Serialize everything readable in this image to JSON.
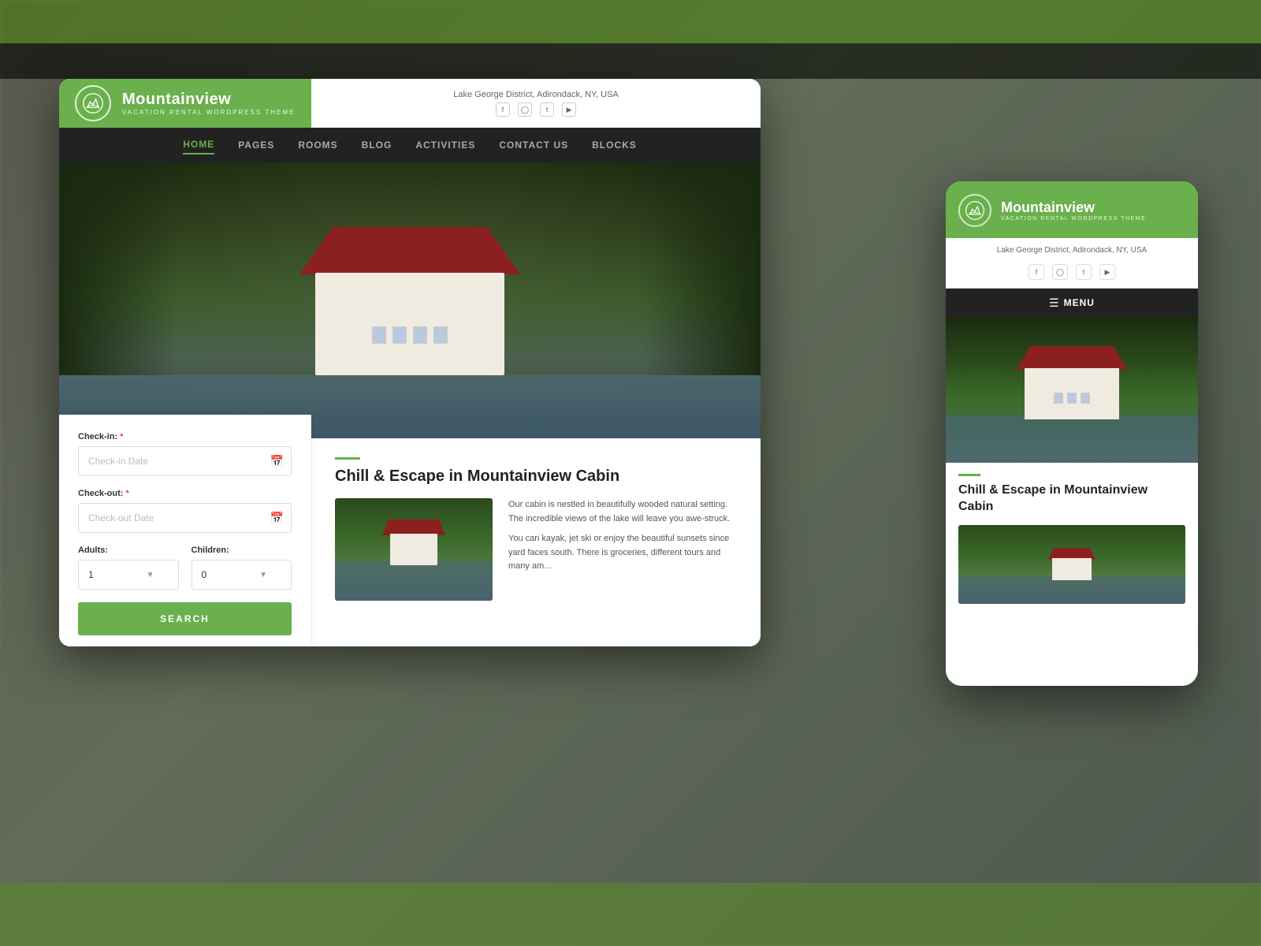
{
  "background": {
    "color": "#555555"
  },
  "desktop": {
    "logo": {
      "title": "Mountainview",
      "subtitle": "VACATION RENTAL WORDPRESS THEME"
    },
    "header": {
      "location": "Lake George District, Adirondack, NY, USA",
      "social": [
        "f",
        "in",
        "tw",
        "yt"
      ]
    },
    "nav": {
      "items": [
        {
          "label": "HOME",
          "active": true
        },
        {
          "label": "PAGES",
          "active": false
        },
        {
          "label": "ROOMS",
          "active": false
        },
        {
          "label": "BLOG",
          "active": false
        },
        {
          "label": "ACTIVITIES",
          "active": false
        },
        {
          "label": "CONTACT US",
          "active": false
        },
        {
          "label": "BLOCKS",
          "active": false
        }
      ]
    },
    "booking": {
      "checkin_label": "Check-in:",
      "checkin_placeholder": "Check-in Date",
      "checkout_label": "Check-out:",
      "checkout_placeholder": "Check-out Date",
      "adults_label": "Adults:",
      "adults_value": "1",
      "children_label": "Children:",
      "children_value": "0",
      "search_button": "SEARCH"
    },
    "content": {
      "section_title": "Chill & Escape in Mountainview Cabin",
      "para1": "Our cabin is nestled in beautifully wooded natural setting. The incredible views of the lake will leave you awe-struck.",
      "para2": "You can kayak, jet ski or enjoy the beautiful sunsets since yard faces south. There is groceries, different tours and many am..."
    }
  },
  "mobile": {
    "logo": {
      "title": "Mountainview",
      "subtitle": "VACATION RENTAL WORDPRESS THEME"
    },
    "header": {
      "location": "Lake George District, Adirondack, NY, USA",
      "social": [
        "f",
        "in",
        "tw",
        "yt"
      ]
    },
    "nav": {
      "menu_label": "MENU"
    },
    "content": {
      "section_title": "Chill & Escape in Mountainview Cabin"
    }
  }
}
